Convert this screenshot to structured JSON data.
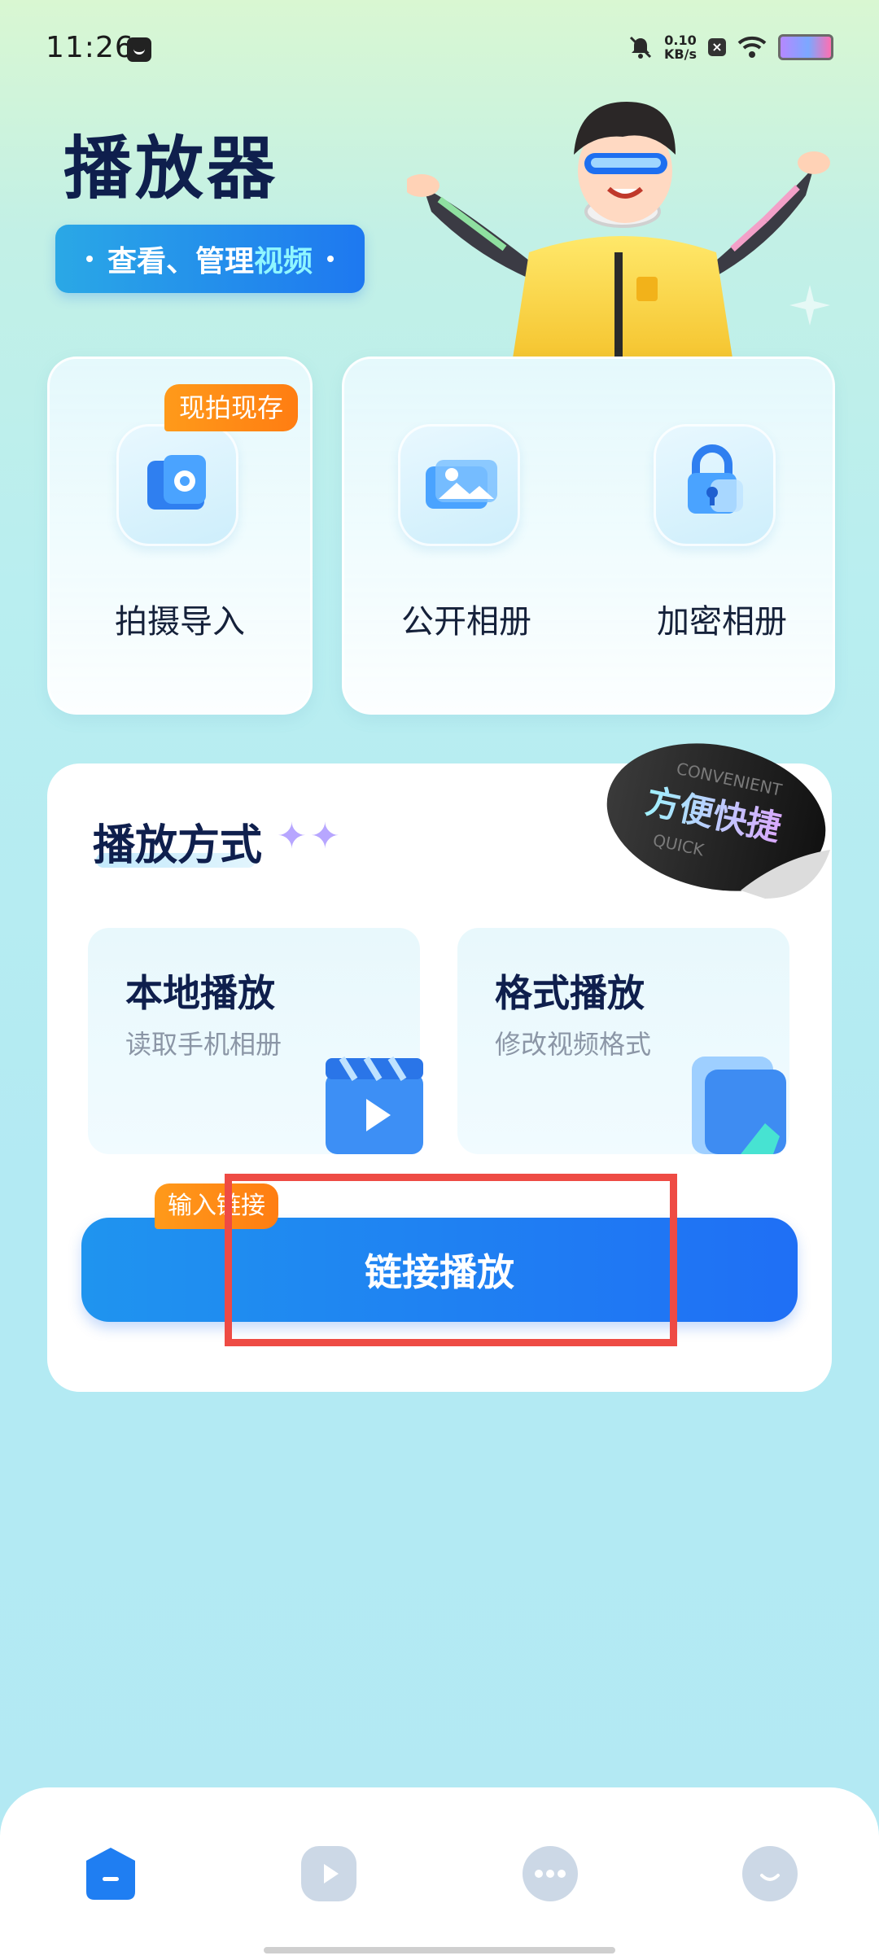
{
  "status_bar": {
    "time": "11:26",
    "speed_value": "0.10",
    "speed_unit": "KB/s"
  },
  "header": {
    "title": "播放器",
    "subtitle_prefix": "查看、管理",
    "subtitle_highlight": "视频"
  },
  "top_cards": {
    "capture": {
      "label": "拍摄导入",
      "badge": "现拍现存"
    },
    "public_album": {
      "label": "公开相册"
    },
    "private_album": {
      "label": "加密相册"
    }
  },
  "play_section": {
    "title": "播放方式",
    "sticker_main": "方便快捷",
    "sticker_top": "CONVENIENT",
    "sticker_bottom": "QUICK",
    "local": {
      "title": "本地播放",
      "desc": "读取手机相册"
    },
    "format": {
      "title": "格式播放",
      "desc": "修改视频格式"
    },
    "link_button": "链接播放",
    "link_badge": "输入链接"
  },
  "colors": {
    "accent": "#1F7EF2",
    "badge": "#FF8A16",
    "title": "#0F1F4D",
    "highlight_box": "#EE4B44"
  },
  "bottom_nav": {
    "items": [
      "home-icon",
      "play-icon",
      "more-icon",
      "profile-icon"
    ],
    "active_index": 0
  }
}
